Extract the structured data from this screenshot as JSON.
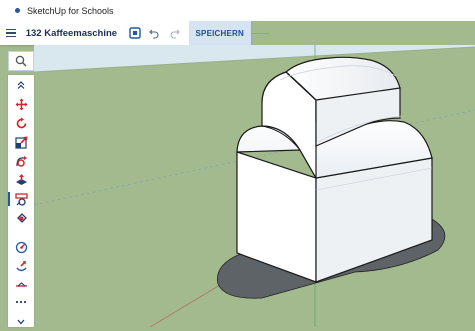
{
  "app": {
    "title": "SketchUp for Schools"
  },
  "toolbar": {
    "model_name": "132 Kaffeemaschine",
    "save_label": "SPEICHERN"
  },
  "icons": {
    "menu": "hamburger-menu-icon",
    "model_info": "model-info-icon",
    "undo": "undo-icon",
    "redo": "redo-icon",
    "search": "search-icon"
  },
  "tools": [
    "collapse-icon",
    "move-icon",
    "rotate-icon",
    "scale-icon",
    "follow-me-icon",
    "push-pull-icon",
    "tape-measure-icon",
    "paint-bucket-icon",
    "orbit-icon",
    "walk-icon",
    "section-icon",
    "more-icon",
    "expand-icon"
  ],
  "colors": {
    "ground": "#a3b98e",
    "sky": "#d9e7ee",
    "accent": "#1d5aa7",
    "shadow": "#5d6366"
  }
}
